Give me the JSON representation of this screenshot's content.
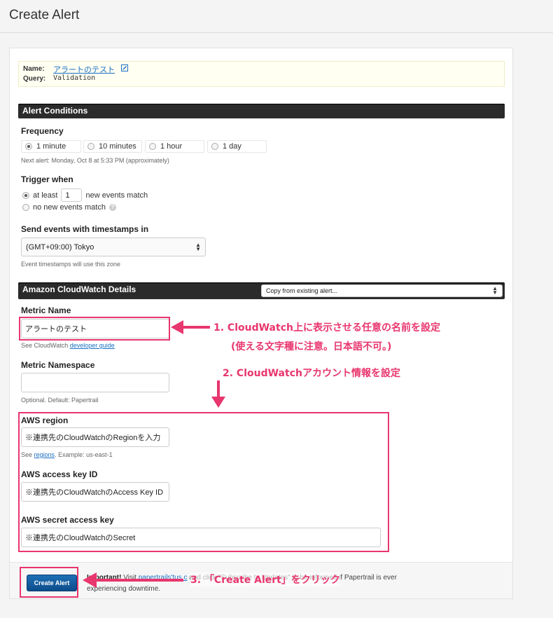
{
  "header": {
    "title": "Create Alert"
  },
  "info": {
    "name_label": "Name:",
    "name_value": "アラートのテスト",
    "query_label": "Query:",
    "query_value": "Validation"
  },
  "alert_conditions": {
    "section_title": "Alert Conditions",
    "frequency_label": "Frequency",
    "frequency_options": [
      "1 minute",
      "10 minutes",
      "1 hour",
      "1 day"
    ],
    "frequency_selected": "1 minute",
    "next_alert": "Next alert: Monday, Oct 8 at 5:33 PM (approximately)",
    "trigger_label": "Trigger when",
    "trigger_at_least": "at least",
    "trigger_count": "1",
    "trigger_new_events": "new events match",
    "trigger_no_events": "no new events match",
    "timestamps_label": "Send events with timestamps in",
    "timezone": "(GMT+09:00) Tokyo",
    "timezone_help": "Event timestamps will use this zone"
  },
  "cloudwatch": {
    "section_title": "Amazon CloudWatch Details",
    "copy_select": "Copy from existing alert...",
    "metric_name_label": "Metric Name",
    "metric_name_value": "アラートのテスト",
    "metric_name_help_prefix": "See CloudWatch",
    "metric_name_help_link": "developer guide",
    "metric_namespace_label": "Metric Namespace",
    "metric_namespace_value": "",
    "metric_namespace_help": "Optional. Default: Papertrail",
    "region_label": "AWS region",
    "region_value": "※連携先のCloudWatchのRegionを入力",
    "region_help_prefix": "See",
    "region_help_link": "regions",
    "region_help_suffix": ". Example: us-east-1",
    "access_key_label": "AWS access key ID",
    "access_key_value": "※連携先のCloudWatchのAccess Key ID",
    "secret_key_label": "AWS secret access key",
    "secret_key_value": "※連携先のCloudWatchのSecret"
  },
  "footer": {
    "button_label": "Create Alert",
    "important_label": "Important!",
    "line1_pre": "Visit",
    "line1_link": "papertrails'tus.c",
    "line1_post": "and click \"Subscribe to Updates\" to be informed if Papertrail is ever",
    "line2": "experiencing downtime."
  },
  "annotations": {
    "step1_line1": "1. CloudWatch上に表示させる任意の名前を設定",
    "step1_line2": "(使える文字種に注意。日本語不可。)",
    "step2": "2. CloudWatchアカウント情報を設定",
    "step3": "3. 「Create Alert」をクリック",
    "color": "#e8366e"
  }
}
